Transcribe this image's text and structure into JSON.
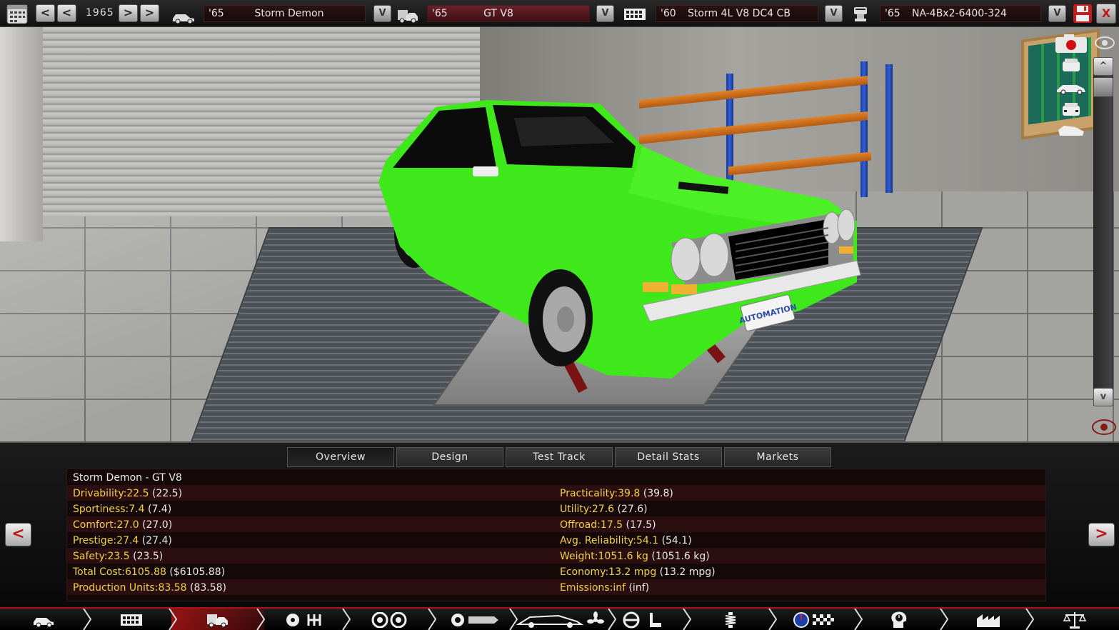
{
  "topbar": {
    "year": "1965",
    "calendar_icon": "calendar-icon",
    "model": {
      "year": "'65",
      "name": "Storm Demon"
    },
    "trim": {
      "year": "'65",
      "name": "GT V8"
    },
    "engine_family": {
      "year": "'60",
      "name": "Storm 4L V8 DC4 CB"
    },
    "engine_variant": {
      "year": "'65",
      "name": "NA-4Bx2-6400-324"
    },
    "drop_label": "V",
    "prev_prev_label": "<",
    "prev_label": "<",
    "next_label": ">",
    "next_next_label": ">",
    "close_label": "X"
  },
  "viewport": {
    "plate_text": "AUTOMATION",
    "scroll_up": "^",
    "scroll_down": "v",
    "colors": {
      "car_body": "#3ee81a",
      "rack_posts": "#2a55c8",
      "rack_beams": "#d7781f",
      "lift_arms": "#7a1414"
    }
  },
  "panel": {
    "tabs": [
      "Overview",
      "Design",
      "Test Track",
      "Detail Stats",
      "Markets"
    ],
    "active_tab": "Overview",
    "title": "Storm Demon - GT V8",
    "left_stats": [
      {
        "label": "Drivability:",
        "value": "22.5",
        "base": "(22.5)"
      },
      {
        "label": "Sportiness:",
        "value": "7.4",
        "base": "(7.4)"
      },
      {
        "label": "Comfort:",
        "value": "27.0",
        "base": "(27.0)"
      },
      {
        "label": "Prestige:",
        "value": "27.4",
        "base": "(27.4)"
      },
      {
        "label": "Safety:",
        "value": "23.5",
        "base": "(23.5)"
      },
      {
        "label": "Total Cost:",
        "value": "6105.88",
        "base": "($6105.88)"
      },
      {
        "label": "Production Units:",
        "value": "83.58",
        "base": "(83.58)"
      }
    ],
    "right_stats": [
      {
        "label": "Practicality:",
        "value": "39.8",
        "base": "(39.8)"
      },
      {
        "label": "Utility:",
        "value": "27.6",
        "base": "(27.6)"
      },
      {
        "label": "Offroad:",
        "value": "17.5",
        "base": "(17.5)"
      },
      {
        "label": "Avg. Reliability:",
        "value": "54.1",
        "base": "(54.1)"
      },
      {
        "label": "Weight:",
        "value": "1051.6 kg",
        "base": "(1051.6 kg)"
      },
      {
        "label": "Economy:",
        "value": "13.2 mpg",
        "base": "(13.2 mpg)"
      },
      {
        "label": "Emissions:",
        "value": "inf",
        "base": "(inf)"
      }
    ],
    "prev_arrow": "<",
    "next_arrow": ">"
  },
  "bottombar": {
    "items": [
      "car-model-icon",
      "engine-block-icon",
      "trim-car-icon",
      "gearbox-icon",
      "wheels-icon",
      "chassis-icon",
      "aero-fan-icon",
      "interior-seat-icon",
      "suspension-icon",
      "test-gauge-icon",
      "engineering-time-icon",
      "factory-icon",
      "balance-scale-icon"
    ],
    "active_index": 2,
    "accent": "#b01010"
  }
}
